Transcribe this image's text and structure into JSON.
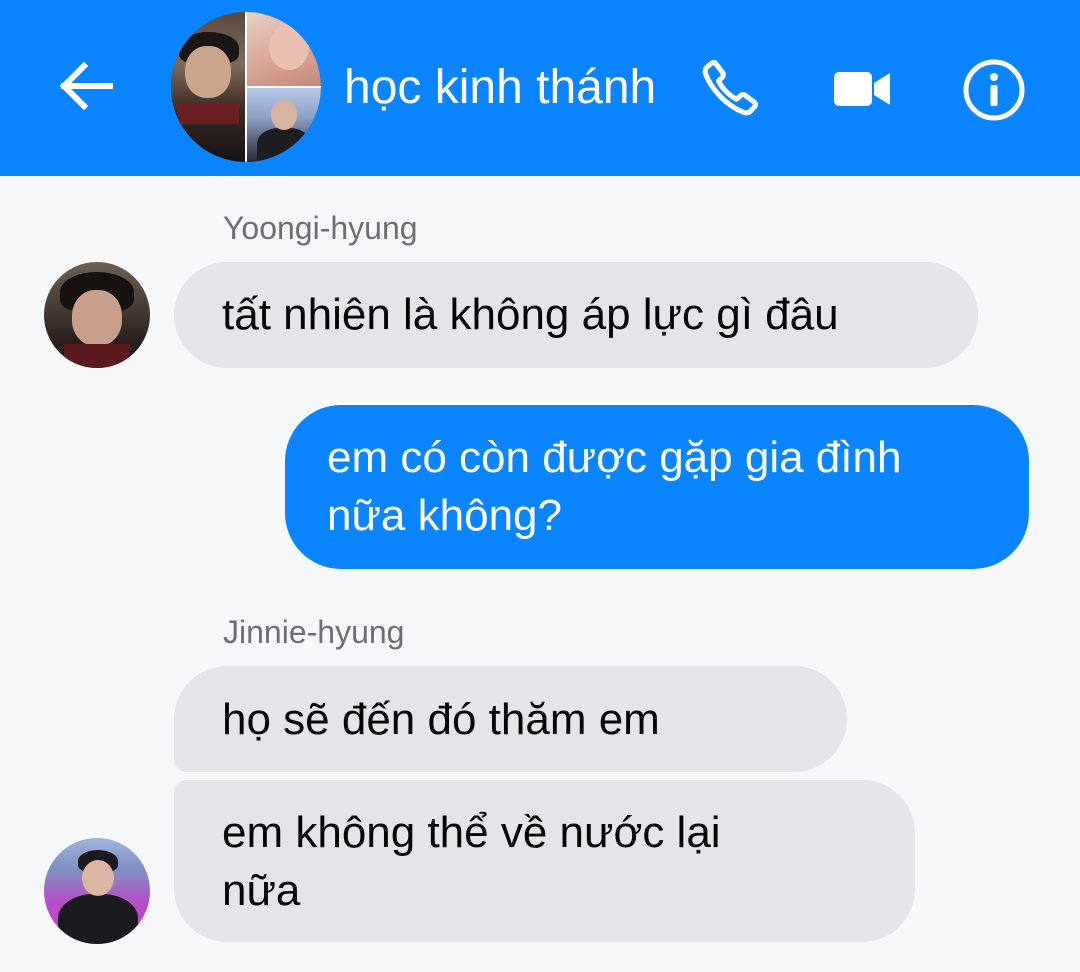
{
  "header": {
    "title": "học kinh thánh",
    "back_icon": "arrow-left-icon",
    "call_icon": "phone-icon",
    "video_icon": "video-camera-icon",
    "info_icon": "info-icon",
    "accent_color": "#0a84ff"
  },
  "messages": [
    {
      "sender": "Yoongi-hyung",
      "direction": "incoming",
      "lines": [
        "tất nhiên là không áp lực gì đâu"
      ]
    },
    {
      "sender": "",
      "direction": "outgoing",
      "lines": [
        "em có còn được gặp gia đình",
        "nữa không?"
      ]
    },
    {
      "sender": "Jinnie-hyung",
      "direction": "incoming",
      "lines": [
        "họ sẽ đến đó thăm em"
      ]
    },
    {
      "sender": "",
      "direction": "incoming",
      "lines": [
        "em không thể về nước lại",
        "nữa"
      ]
    }
  ],
  "colors": {
    "incoming_bubble": "#e4e5e9",
    "outgoing_bubble": "#0a84ff",
    "background": "#f7f8fa",
    "sender_name": "#6b6e73"
  }
}
